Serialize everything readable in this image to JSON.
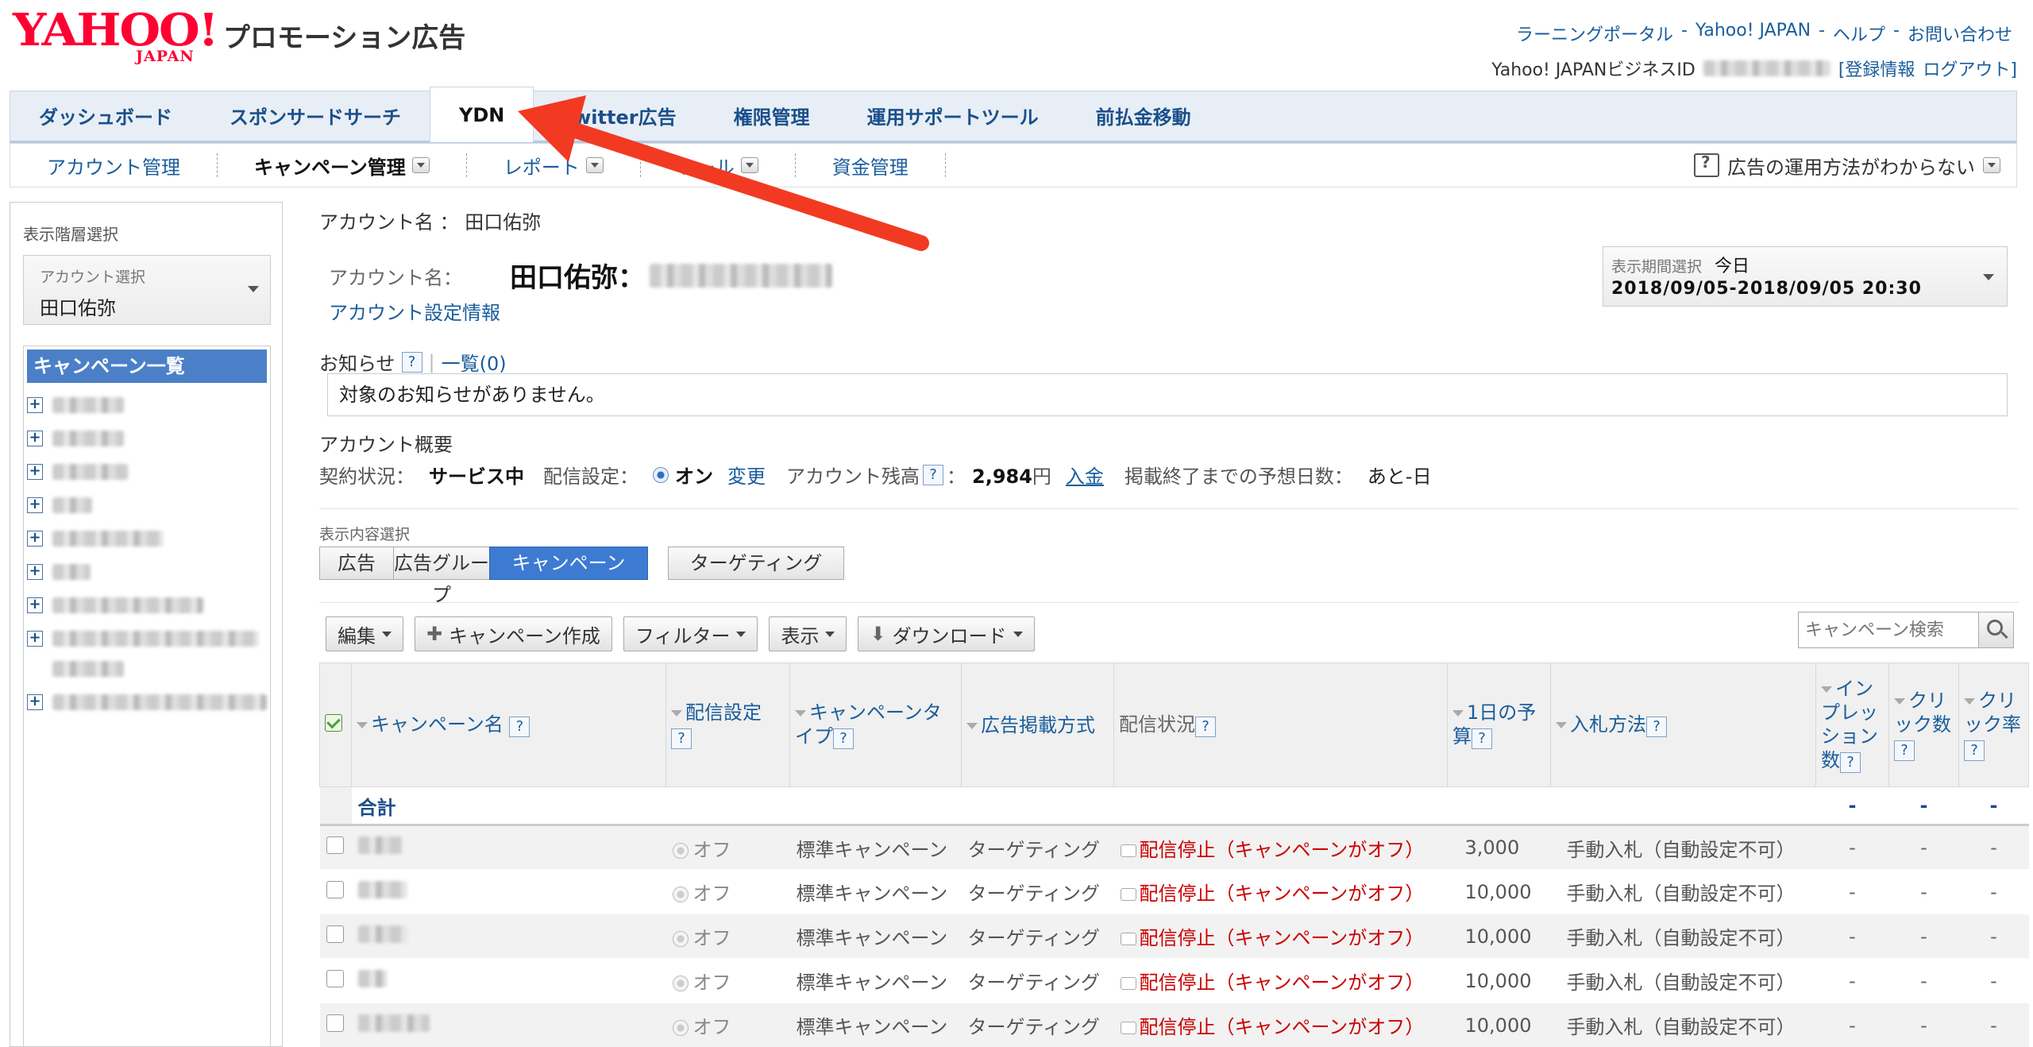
{
  "header": {
    "logo_word": "YAHOO!",
    "logo_sub": "JAPAN",
    "product": "プロモーション広告",
    "links": [
      "ラーニングポータル",
      "Yahoo! JAPAN",
      "ヘルプ",
      "お問い合わせ"
    ],
    "link_sep": "-",
    "business_id_label": "Yahoo! JAPANビジネスID",
    "account_info": "[登録情報",
    "logout": "ログアウト]"
  },
  "main_tabs": [
    "ダッシュボード",
    "スポンサードサーチ",
    "YDN",
    "Twitter広告",
    "権限管理",
    "運用サポートツール",
    "前払金移動"
  ],
  "active_main_tab": "YDN",
  "sub_nav": {
    "items": [
      "アカウント管理",
      "キャンペーン管理",
      "レポート",
      "ツール",
      "資金管理"
    ],
    "help": "広告の運用方法がわからない"
  },
  "sidebar": {
    "hierarchy_label": "表示階層選択",
    "account_select_caption": "アカウント選択",
    "account_select_value": "田口佑弥",
    "campaign_list_title": "キャンペーン一覧"
  },
  "content": {
    "breadcrumb": "アカウント名 ： 田口佑弥",
    "account_label": "アカウント名：",
    "account_name": "田口佑弥：",
    "account_settings_link": "アカウント設定情報",
    "period_caption": "表示期間選択",
    "period_value": "今日",
    "period_range": "2018/09/05-2018/09/05 20:30",
    "notice_title": "お知らせ",
    "notice_list": "一覧(0)",
    "notice_text": "対象のお知らせがありません。",
    "overview_title": "アカウント概要",
    "contract_label": "契約状況：",
    "contract_value": "サービス中",
    "delivery_label": "配信設定：",
    "delivery_value": "オン",
    "change_link": "変更",
    "balance_label": "アカウント残高",
    "balance_value": "2,984",
    "balance_unit": "円",
    "deposit_link": "入金",
    "days_label": "掲載終了までの予想日数：",
    "days_value": "あと-日",
    "display_select_label": "表示内容選択",
    "segments": [
      "広告",
      "広告グループ",
      "キャンペーン",
      "ターゲティング"
    ],
    "active_segment": "キャンペーン",
    "toolbar": [
      "編集",
      "キャンペーン作成",
      "フィルター",
      "表示",
      "ダウンロード"
    ],
    "search_placeholder": "キャンペーン検索"
  },
  "table": {
    "headers": [
      "キャンペーン名",
      "配信設定",
      "キャンペーンタイプ",
      "広告掲載方式",
      "配信状況",
      "1日の予算",
      "入札方法",
      "インプレッション数",
      "クリック数",
      "クリック率"
    ],
    "total_label": "合計",
    "total_values": [
      "-",
      "-",
      "-"
    ],
    "rows": [
      {
        "setting": "オフ",
        "type": "標準キャンペーン",
        "method": "ターゲティング",
        "status": "配信停止（キャンペーンがオフ）",
        "budget": "3,000",
        "bid": "手動入札（自動設定不可）",
        "imp": "-",
        "clicks": "-",
        "ctr": "-"
      },
      {
        "setting": "オフ",
        "type": "標準キャンペーン",
        "method": "ターゲティング",
        "status": "配信停止（キャンペーンがオフ）",
        "budget": "10,000",
        "bid": "手動入札（自動設定不可）",
        "imp": "-",
        "clicks": "-",
        "ctr": "-"
      },
      {
        "setting": "オフ",
        "type": "標準キャンペーン",
        "method": "ターゲティング",
        "status": "配信停止（キャンペーンがオフ）",
        "budget": "10,000",
        "bid": "手動入札（自動設定不可）",
        "imp": "-",
        "clicks": "-",
        "ctr": "-"
      },
      {
        "setting": "オフ",
        "type": "標準キャンペーン",
        "method": "ターゲティング",
        "status": "配信停止（キャンペーンがオフ）",
        "budget": "10,000",
        "bid": "手動入札（自動設定不可）",
        "imp": "-",
        "clicks": "-",
        "ctr": "-"
      },
      {
        "setting": "オフ",
        "type": "標準キャンペーン",
        "method": "ターゲティング",
        "status": "配信停止（キャンペーンがオフ）",
        "budget": "10,000",
        "bid": "手動入札（自動設定不可）",
        "imp": "-",
        "clicks": "-",
        "ctr": "-"
      }
    ]
  },
  "colors": {
    "brand_red": "#ff0033",
    "link_blue": "#1a5d9c",
    "active_segment": "#3d7bd2",
    "status_red": "#cc0000",
    "annotation_arrow": "#f23a22"
  }
}
